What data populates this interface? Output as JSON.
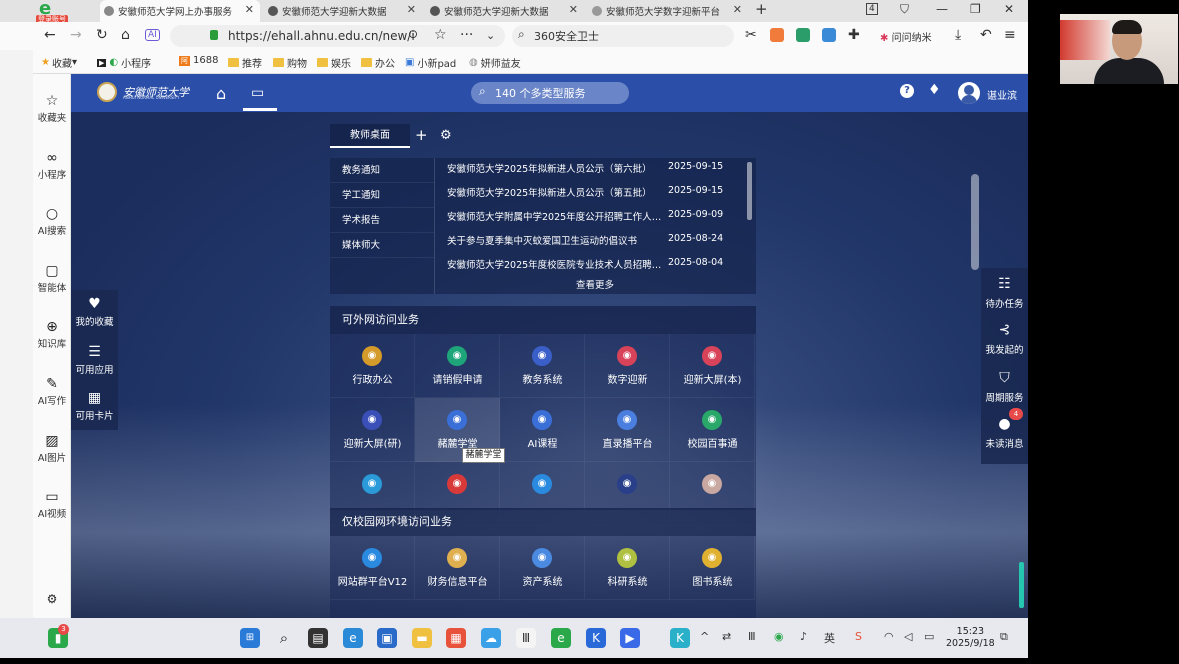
{
  "browser": {
    "badge": "登录账号",
    "tabs": [
      {
        "title": "安徽师范大学网上办事服务"
      },
      {
        "title": "安徽师范大学迎新大数据"
      },
      {
        "title": "安徽师范大学迎新大数据"
      },
      {
        "title": "安徽师范大学数字迎新平台"
      }
    ],
    "new_tab": "+",
    "tab_counter": "4",
    "url": "https://ehall.ahnu.edu.cn/new/i",
    "search_placeholder": "360安全卫士",
    "ext_label": "问问纳米",
    "window_controls": [
      "—",
      "❐",
      "✕"
    ]
  },
  "bookmarks": [
    {
      "label": "收藏"
    },
    {
      "label": "小程序"
    },
    {
      "label": "1688"
    },
    {
      "label": "推荐"
    },
    {
      "label": "购物"
    },
    {
      "label": "娱乐"
    },
    {
      "label": "办公"
    },
    {
      "label": "小新pad"
    },
    {
      "label": "妍师益友"
    }
  ],
  "browser_sidebar": [
    {
      "label": "收藏夹",
      "icon": "star-icon"
    },
    {
      "label": "小程序",
      "icon": "link-icon"
    },
    {
      "label": "AI搜索",
      "icon": "search-icon"
    },
    {
      "label": "智能体",
      "icon": "bot-icon"
    },
    {
      "label": "知识库",
      "icon": "plus-circle-icon"
    },
    {
      "label": "AI写作",
      "icon": "pen-icon"
    },
    {
      "label": "AI图片",
      "icon": "image-icon"
    },
    {
      "label": "AI视频",
      "icon": "video-icon"
    }
  ],
  "site": {
    "logo_name": "安徽师范大学",
    "logo_sub": "ANHUI NORMAL UNIVERSITY",
    "search_label": "140 个多类型服务",
    "user_name": "谌业滨"
  },
  "left_float": [
    {
      "label": "我的收藏"
    },
    {
      "label": "可用应用"
    },
    {
      "label": "可用卡片"
    }
  ],
  "right_float": [
    {
      "label": "待办任务"
    },
    {
      "label": "我发起的"
    },
    {
      "label": "周期服务"
    },
    {
      "label": "未读消息"
    }
  ],
  "unread_count": "4",
  "desk_tab": "教师桌面",
  "notice": {
    "categories": [
      "教务通知",
      "学工通知",
      "学术报告",
      "媒体师大"
    ],
    "items": [
      {
        "title": "安徽师范大学2025年拟新进人员公示（第六批）",
        "date": "2025-09-15"
      },
      {
        "title": "安徽师范大学2025年拟新进人员公示（第五批）",
        "date": "2025-09-15"
      },
      {
        "title": "安徽师范大学附属中学2025年度公开招聘工作人员...",
        "date": "2025-09-09"
      },
      {
        "title": "关于参与夏季集中灭蚊爱国卫生运动的倡议书",
        "date": "2025-08-24"
      },
      {
        "title": "安徽师范大学2025年度校医院专业技术人员招聘公...",
        "date": "2025-08-04"
      }
    ],
    "more": "查看更多"
  },
  "sections": [
    {
      "title": "可外网访问业务",
      "items": [
        {
          "label": "行政办公",
          "color": "#d49a2a"
        },
        {
          "label": "请销假申请",
          "color": "#1fa57a"
        },
        {
          "label": "教务系统",
          "color": "#3a5fc8"
        },
        {
          "label": "数字迎新",
          "color": "#d8435a"
        },
        {
          "label": "迎新大屏(本)",
          "color": "#d8435a"
        },
        {
          "label": "迎新大屏(研)",
          "color": "#3a4fb8"
        },
        {
          "label": "赭麓学堂",
          "color": "#3a6fd8"
        },
        {
          "label": "AI课程",
          "color": "#3a6fd8"
        },
        {
          "label": "直录播平台",
          "color": "#4a7fe0"
        },
        {
          "label": "校园百事通",
          "color": "#2aa86a"
        },
        {
          "label": "",
          "color": "#2a9ad8"
        },
        {
          "label": "",
          "color": "#d83a3a"
        },
        {
          "label": "",
          "color": "#2a8ae0"
        },
        {
          "label": "",
          "color": "#2a3f8a"
        },
        {
          "label": "",
          "color": "#c8a8a0"
        }
      ]
    },
    {
      "title": "仅校园网环境访问业务",
      "items": [
        {
          "label": "网站群平台V12",
          "color": "#2a8ae0"
        },
        {
          "label": "财务信息平台",
          "color": "#e0b050"
        },
        {
          "label": "资产系统",
          "color": "#4a8ae0"
        },
        {
          "label": "科研系统",
          "color": "#b0c040"
        },
        {
          "label": "图书系统",
          "color": "#e0b030"
        }
      ]
    }
  ],
  "tooltip": "赭麓学堂",
  "taskbar": {
    "badge": "3",
    "time": "15:23",
    "date": "2025/9/18"
  }
}
